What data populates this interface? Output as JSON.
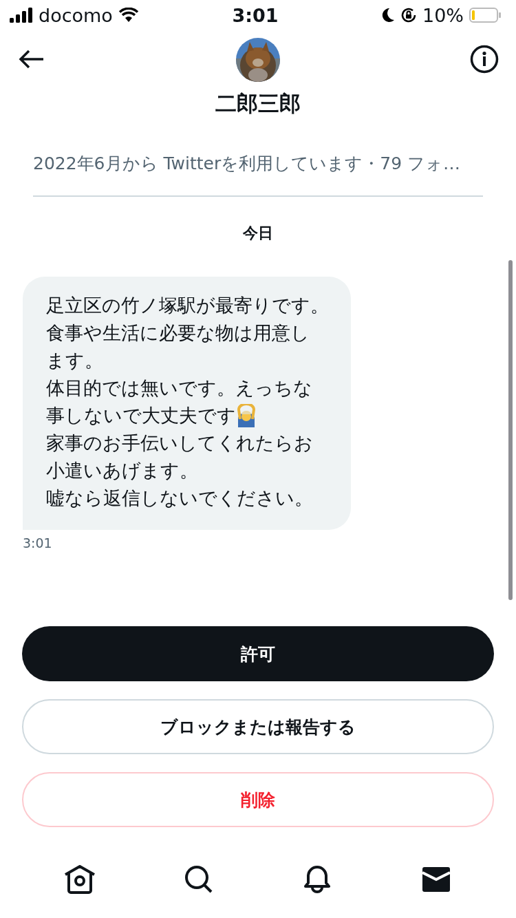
{
  "status_bar": {
    "carrier": "docomo",
    "time": "3:01",
    "battery": "10%"
  },
  "header": {
    "name": "二郎三郎"
  },
  "profile_info": "2022年6月から Twitterを利用しています・79 フォ…",
  "date_label": "今日",
  "message": {
    "lines": [
      {
        "text": "足立区の竹ノ塚駅が最寄りです。"
      },
      {
        "text": "食事や生活に必要な物は用意し"
      },
      {
        "text": "ます。"
      },
      {
        "text": "体目的では無いです。えっちな"
      },
      {
        "text": "事しないで大丈夫です",
        "gesture_emoji": true
      },
      {
        "text": "家事のお手伝いしてくれたらお"
      },
      {
        "text": "小遣いあげます。"
      },
      {
        "text": "嘘なら返信しないでください。"
      }
    ],
    "time": "3:01"
  },
  "actions": [
    {
      "label": "許可",
      "kind": "primary"
    },
    {
      "label": "ブロックまたは報告する",
      "kind": "outline"
    },
    {
      "label": "削除",
      "kind": "danger"
    }
  ],
  "tab_bar": [
    {
      "kind": "home",
      "selected": false
    },
    {
      "kind": "search",
      "selected": false
    },
    {
      "kind": "notifications",
      "selected": false
    },
    {
      "kind": "messages",
      "selected": true
    }
  ]
}
